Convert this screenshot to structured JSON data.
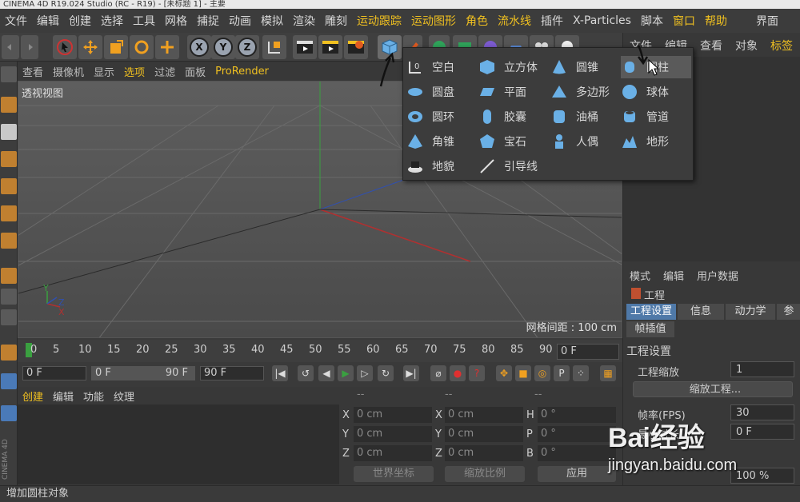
{
  "window": {
    "title": "CINEMA 4D R19.024 Studio (RC - R19) - [未标题 1] - 主要"
  },
  "menubar": {
    "items": [
      "文件",
      "编辑",
      "创建",
      "选择",
      "工具",
      "网格",
      "捕捉",
      "动画",
      "模拟",
      "渲染",
      "雕刻",
      "运动跟踪",
      "运动图形",
      "角色",
      "流水线",
      "插件",
      "X-Particles",
      "脚本",
      "窗口",
      "帮助"
    ],
    "right": "界面"
  },
  "viewport_menu": [
    "查看",
    "摄像机",
    "显示",
    "选项",
    "过滤",
    "面板",
    "ProRender"
  ],
  "viewport": {
    "label": "透视视图",
    "grid_spacing": "网格间距 : 100 cm"
  },
  "timeline": {
    "ticks": [
      "0",
      "5",
      "10",
      "15",
      "20",
      "25",
      "30",
      "35",
      "40",
      "45",
      "50",
      "55",
      "60",
      "65",
      "70",
      "75",
      "80",
      "85",
      "90"
    ],
    "current": "0 F"
  },
  "playbar": {
    "start": "0 F",
    "min": "0 F",
    "max": "90 F",
    "end": "90 F"
  },
  "material_menu": [
    "创建",
    "编辑",
    "功能",
    "纹理"
  ],
  "coords": {
    "headers": [
      "--",
      "--",
      "--"
    ],
    "rows": [
      {
        "a": "X",
        "av": "0 cm",
        "b": "X",
        "bv": "0 cm",
        "c": "H",
        "cv": "0 °"
      },
      {
        "a": "Y",
        "av": "0 cm",
        "b": "Y",
        "bv": "0 cm",
        "c": "P",
        "cv": "0 °"
      },
      {
        "a": "Z",
        "av": "0 cm",
        "b": "Z",
        "bv": "0 cm",
        "c": "B",
        "cv": "0 °"
      }
    ],
    "world": "世界坐标",
    "scale": "缩放比例",
    "apply": "应用"
  },
  "object_tabs": [
    "文件",
    "编辑",
    "查看",
    "对象",
    "标签"
  ],
  "attr_tabs": [
    "模式",
    "编辑",
    "用户数据"
  ],
  "project": {
    "title": "工程",
    "tabs": [
      "工程设置",
      "信息",
      "动力学",
      "参"
    ],
    "subtab": "帧插值",
    "section": "工程设置",
    "scale_label": "工程缩放",
    "scale_value": "1",
    "scale_button": "缩放工程...",
    "fps_label": "帧率(FPS)",
    "fps_value": "30",
    "min_label": "最小时长",
    "min_value": "0 F",
    "pct": "100 %"
  },
  "popup": {
    "items": [
      [
        "空白",
        "立方体",
        "圆锥",
        "圆柱"
      ],
      [
        "圆盘",
        "平面",
        "多边形",
        "球体"
      ],
      [
        "圆环",
        "胶囊",
        "油桶",
        "管道"
      ],
      [
        "角锥",
        "宝石",
        "人偶",
        "地形"
      ],
      [
        "地貌",
        "引导线"
      ]
    ]
  },
  "status": "增加圆柱对象",
  "brand": "CINEMA 4D",
  "watermark": {
    "line1": "Bai经验",
    "line2": "jingyan.baidu.com"
  },
  "colors": {
    "accent": "#f0c020",
    "active_tab": "#4f79a8",
    "popup_bg": "#3c3c3c"
  }
}
